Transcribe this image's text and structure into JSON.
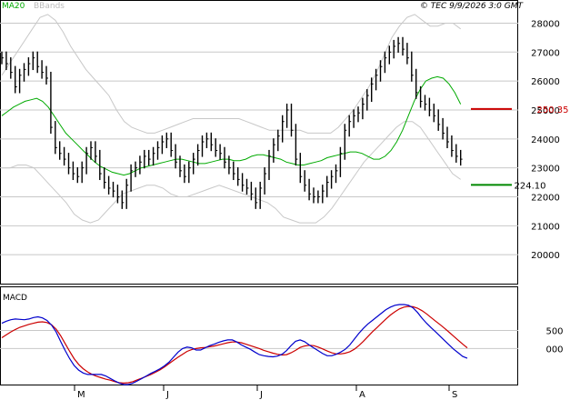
{
  "header": {
    "ma_label": "MA20",
    "bb_label": "BBands",
    "timestamp": "© TEC 9/9/2026 3:0 GMT"
  },
  "colors": {
    "ma": "#00aa00",
    "bands": "#c8c8c8",
    "bars": "#000000",
    "macd": "#0000cc",
    "signal": "#cc0000",
    "resistance": "#cc0000",
    "support": "#008800",
    "grid": "#c8c8c8",
    "ma_label": "#00aa00",
    "bb_label": "#bbbbbb"
  },
  "chart_data": [
    {
      "type": "line",
      "panel": "price",
      "y_ticks": [
        20000,
        21000,
        22000,
        23000,
        24000,
        25000,
        26000,
        27000,
        28000
      ],
      "y_tick_labels": [
        "20000",
        "21000",
        "22000",
        "23000",
        "24000",
        "25000",
        "26000",
        "27000",
        "28000"
      ],
      "ylim": [
        19000,
        28800
      ],
      "x_tick_labels": [
        {
          "label": "M",
          "bar": 25
        },
        {
          "label": "J",
          "bar": 50
        },
        {
          "label": "J",
          "bar": 78
        },
        {
          "label": "A",
          "bar": 108
        },
        {
          "label": "S",
          "bar": 135
        }
      ],
      "bars_close": [
        26800,
        26600,
        26300,
        25800,
        26200,
        26400,
        26600,
        26800,
        26500,
        26300,
        26100,
        24400,
        23700,
        23500,
        23300,
        23000,
        22800,
        22700,
        23000,
        23500,
        23700,
        23400,
        22800,
        22500,
        22300,
        22200,
        22000,
        21800,
        22400,
        22900,
        23000,
        23200,
        23400,
        23300,
        23500,
        23700,
        23900,
        24000,
        23600,
        23200,
        22900,
        22700,
        23000,
        23300,
        23600,
        23900,
        24000,
        23800,
        23600,
        23500,
        23200,
        23000,
        22800,
        22600,
        22400,
        22300,
        22100,
        21800,
        22300,
        22800,
        23400,
        23800,
        24100,
        24600,
        25000,
        24300,
        23300,
        22700,
        22400,
        22100,
        22000,
        22000,
        22200,
        22500,
        22700,
        22900,
        23500,
        24300,
        24600,
        24800,
        24900,
        25200,
        25500,
        25900,
        26200,
        26500,
        26800,
        27000,
        27200,
        27300,
        27100,
        26800,
        26200,
        25600,
        25300,
        25200,
        25000,
        24800,
        24500,
        24200,
        23900,
        23600,
        23400,
        23300
      ],
      "ma20": [
        24800,
        24950,
        25100,
        25200,
        25300,
        25350,
        25400,
        25300,
        25100,
        24800,
        24500,
        24200,
        24000,
        23800,
        23600,
        23400,
        23200,
        23050,
        22950,
        22850,
        22800,
        22750,
        22800,
        22900,
        23000,
        23050,
        23100,
        23150,
        23200,
        23250,
        23300,
        23300,
        23250,
        23200,
        23150,
        23150,
        23200,
        23250,
        23300,
        23300,
        23250,
        23250,
        23300,
        23400,
        23450,
        23450,
        23400,
        23350,
        23300,
        23200,
        23150,
        23100,
        23100,
        23150,
        23200,
        23250,
        23350,
        23400,
        23450,
        23500,
        23550,
        23550,
        23500,
        23400,
        23300,
        23300,
        23400,
        23600,
        23900,
        24300,
        24800,
        25300,
        25700,
        26000,
        26100,
        26150,
        26100,
        25900,
        25600,
        25200
      ],
      "bb_upper": [
        26200,
        26600,
        27000,
        27400,
        27800,
        28200,
        28300,
        28100,
        27700,
        27200,
        26800,
        26400,
        26100,
        25800,
        25500,
        25000,
        24600,
        24400,
        24300,
        24200,
        24200,
        24300,
        24400,
        24500,
        24600,
        24700,
        24700,
        24700,
        24700,
        24700,
        24700,
        24700,
        24600,
        24500,
        24400,
        24300,
        24300,
        24300,
        24300,
        24300,
        24200,
        24200,
        24200,
        24200,
        24400,
        24700,
        25000,
        25400,
        25800,
        26300,
        26900,
        27500,
        27900,
        28200,
        28300,
        28100,
        27900,
        27900,
        28000,
        28000,
        27800
      ],
      "bb_lower": [
        23000,
        23000,
        23100,
        23100,
        23000,
        22700,
        22400,
        22100,
        21800,
        21400,
        21200,
        21100,
        21200,
        21500,
        21800,
        22100,
        22200,
        22300,
        22400,
        22400,
        22300,
        22100,
        22000,
        22000,
        22100,
        22200,
        22300,
        22400,
        22300,
        22200,
        22100,
        22000,
        21900,
        21800,
        21600,
        21300,
        21200,
        21100,
        21100,
        21100,
        21300,
        21600,
        22000,
        22400,
        22800,
        23200,
        23500,
        23800,
        24100,
        24400,
        24600,
        24600,
        24400,
        24000,
        23600,
        23200,
        22800,
        22600
      ],
      "resistance": {
        "value": 25035,
        "label": "250.35"
      },
      "support": {
        "value": 22410,
        "label": "224.10"
      }
    },
    {
      "type": "line",
      "panel": "macd",
      "title": "MACD",
      "y_ticks": [
        0,
        500
      ],
      "y_tick_labels": [
        "000",
        "500"
      ],
      "ylim": [
        -1000,
        1700
      ],
      "macd": [
        700,
        760,
        800,
        820,
        810,
        800,
        820,
        860,
        880,
        850,
        780,
        650,
        460,
        200,
        -50,
        -280,
        -470,
        -600,
        -680,
        -720,
        -720,
        -720,
        -720,
        -760,
        -830,
        -900,
        -960,
        -1000,
        -1000,
        -960,
        -900,
        -830,
        -760,
        -690,
        -630,
        -560,
        -480,
        -380,
        -240,
        -100,
        0,
        40,
        20,
        -40,
        -40,
        20,
        80,
        120,
        170,
        210,
        240,
        240,
        180,
        100,
        40,
        -20,
        -100,
        -170,
        -200,
        -220,
        -230,
        -210,
        -160,
        -60,
        80,
        200,
        240,
        190,
        100,
        20,
        -60,
        -140,
        -200,
        -200,
        -160,
        -100,
        -20,
        100,
        260,
        420,
        560,
        680,
        780,
        880,
        980,
        1080,
        1150,
        1200,
        1220,
        1220,
        1200,
        1130,
        1000,
        840,
        700,
        580,
        460,
        340,
        220,
        100,
        -20,
        -120,
        -220,
        -270
      ],
      "signal": [
        300,
        380,
        460,
        530,
        590,
        630,
        670,
        700,
        730,
        740,
        720,
        660,
        540,
        360,
        140,
        -80,
        -280,
        -440,
        -560,
        -650,
        -720,
        -770,
        -810,
        -850,
        -880,
        -920,
        -950,
        -960,
        -950,
        -920,
        -870,
        -820,
        -770,
        -720,
        -660,
        -590,
        -510,
        -420,
        -330,
        -240,
        -160,
        -80,
        -30,
        0,
        20,
        30,
        50,
        70,
        100,
        130,
        160,
        180,
        180,
        160,
        120,
        80,
        40,
        0,
        -50,
        -90,
        -130,
        -160,
        -180,
        -170,
        -120,
        -50,
        30,
        70,
        90,
        80,
        40,
        -10,
        -70,
        -120,
        -150,
        -150,
        -130,
        -90,
        -20,
        80,
        200,
        330,
        460,
        580,
        700,
        820,
        930,
        1020,
        1100,
        1150,
        1170,
        1160,
        1120,
        1050,
        960,
        860,
        760,
        660,
        560,
        450,
        340,
        230,
        120,
        20
      ],
      "x_tick_labels": [
        "M",
        "J",
        "J",
        "A",
        "S"
      ]
    }
  ]
}
